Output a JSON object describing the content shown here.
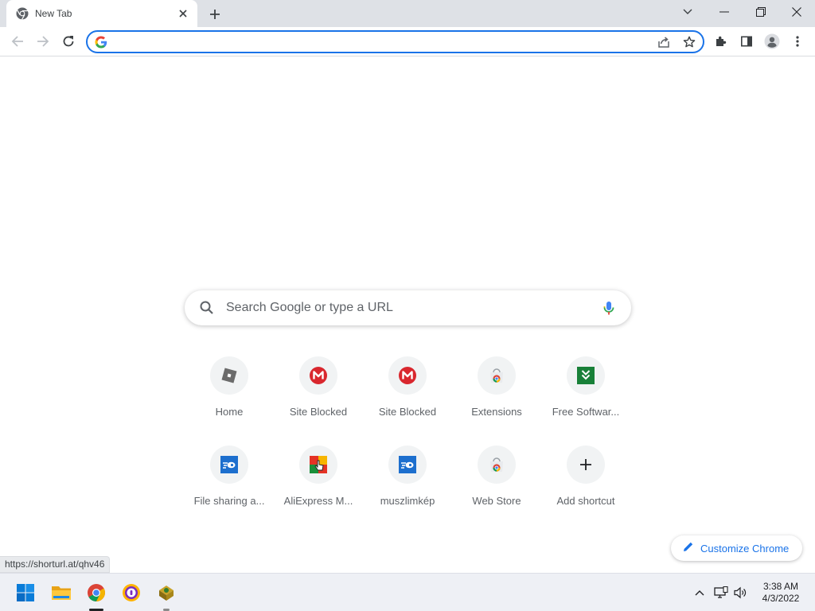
{
  "browser": {
    "tab": {
      "title": "New Tab"
    },
    "omnibox": {
      "value": "",
      "placeholder": ""
    }
  },
  "ntp": {
    "search": {
      "placeholder": "Search Google or type a URL"
    },
    "shortcuts": [
      {
        "title": "Home",
        "icon": "roblox-icon"
      },
      {
        "title": "Site Blocked",
        "icon": "mega-icon"
      },
      {
        "title": "Site Blocked",
        "icon": "mega-icon"
      },
      {
        "title": "Extensions",
        "icon": "chrome-web-store-icon"
      },
      {
        "title": "Free Softwar...",
        "icon": "download-icon"
      },
      {
        "title": "File sharing a...",
        "icon": "mediafire-icon"
      },
      {
        "title": "AliExpress M...",
        "icon": "aliexpress-icon"
      },
      {
        "title": "muszlimkép",
        "icon": "mediafire-icon"
      },
      {
        "title": "Web Store",
        "icon": "chrome-web-store-icon"
      },
      {
        "title": "Add shortcut",
        "icon": "plus-icon"
      }
    ],
    "customize_label": "Customize Chrome"
  },
  "status_url": "https://shorturl.at/qhv46",
  "taskbar": {
    "time": "3:38 AM",
    "date": "4/3/2022"
  },
  "colors": {
    "accent": "#1a73e8",
    "mega": "#d9272e",
    "mediafire": "#1d6fce",
    "download": "#188038"
  }
}
